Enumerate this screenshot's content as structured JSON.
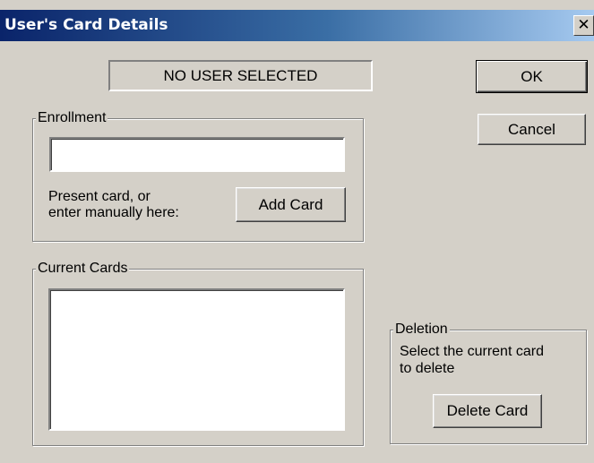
{
  "window": {
    "title": "User's Card Details",
    "close_glyph": "✕",
    "close_icon": "close-icon"
  },
  "status_text": "NO USER SELECTED",
  "buttons": {
    "ok": "OK",
    "cancel": "Cancel",
    "add_card": "Add Card",
    "delete_card": "Delete Card"
  },
  "enrollment": {
    "legend": "Enrollment",
    "card_input_value": "",
    "help_line1": "Present card, or",
    "help_line2": "enter manually here:"
  },
  "current_cards": {
    "legend": "Current Cards",
    "items": []
  },
  "deletion": {
    "legend": "Deletion",
    "help_line1": "Select the current card",
    "help_line2": "to delete"
  },
  "colors": {
    "face": "#d4d0c8",
    "title_start": "#0a246a",
    "title_end": "#a6caf0"
  }
}
